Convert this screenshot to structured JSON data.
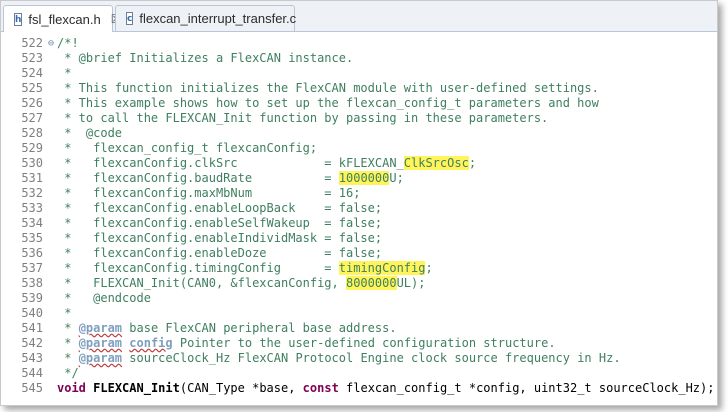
{
  "tabs": [
    {
      "label": "fsl_flexcan.h",
      "icon": "header-file-icon",
      "glyph": "h",
      "close": "☒",
      "active": true
    },
    {
      "label": "flexcan_interrupt_transfer.c",
      "icon": "c-file-icon",
      "glyph": "c",
      "active": false
    }
  ],
  "editor": {
    "fold_marker": "⊖",
    "lines": [
      {
        "num": "522",
        "segs": [
          {
            "t": "/*!"
          }
        ]
      },
      {
        "num": "523",
        "segs": [
          {
            "t": " * @brief Initializes a FlexCAN instance."
          }
        ]
      },
      {
        "num": "524",
        "segs": [
          {
            "t": " *"
          }
        ]
      },
      {
        "num": "525",
        "segs": [
          {
            "t": " * This function initializes the FlexCAN module with user-defined settings."
          }
        ]
      },
      {
        "num": "526",
        "segs": [
          {
            "t": " * This example shows how to set up the flexcan_config_t parameters and how"
          }
        ]
      },
      {
        "num": "527",
        "segs": [
          {
            "t": " * to call the FLEXCAN_Init function by passing in these parameters."
          }
        ]
      },
      {
        "num": "528",
        "segs": [
          {
            "t": " *  @code"
          }
        ]
      },
      {
        "num": "529",
        "segs": [
          {
            "t": " *   flexcan_config_t flexcanConfig;"
          }
        ]
      },
      {
        "num": "530",
        "segs": [
          {
            "t": " *   flexcanConfig.clkSrc            = kFLEXCAN_"
          },
          {
            "t": "ClkSrcOsc",
            "hl": true
          },
          {
            "t": ";"
          }
        ]
      },
      {
        "num": "531",
        "segs": [
          {
            "t": " *   flexcanConfig.baudRate          = "
          },
          {
            "t": "1000000",
            "hl": true
          },
          {
            "t": "U;"
          }
        ]
      },
      {
        "num": "532",
        "segs": [
          {
            "t": " *   flexcanConfig.maxMbNum          = 16;"
          }
        ]
      },
      {
        "num": "533",
        "segs": [
          {
            "t": " *   flexcanConfig.enableLoopBack    = false;"
          }
        ]
      },
      {
        "num": "534",
        "segs": [
          {
            "t": " *   flexcanConfig.enableSelfWakeup  = false;"
          }
        ]
      },
      {
        "num": "535",
        "segs": [
          {
            "t": " *   flexcanConfig.enableIndividMask = false;"
          }
        ]
      },
      {
        "num": "536",
        "segs": [
          {
            "t": " *   flexcanConfig.enableDoze        = false;"
          }
        ]
      },
      {
        "num": "537",
        "segs": [
          {
            "t": " *   flexcanConfig.timingConfig      = "
          },
          {
            "t": "timingConfig",
            "hl": true
          },
          {
            "t": ";"
          }
        ]
      },
      {
        "num": "538",
        "segs": [
          {
            "t": " *   FLEXCAN_Init(CAN0, &flexcanConfig, "
          },
          {
            "t": "8000000",
            "hl": true
          },
          {
            "t": "UL);"
          }
        ]
      },
      {
        "num": "539",
        "segs": [
          {
            "t": " *   @endcode"
          }
        ]
      },
      {
        "num": "540",
        "segs": [
          {
            "t": " *"
          }
        ]
      },
      {
        "num": "541",
        "segs": [
          {
            "t": " * "
          },
          {
            "t": "@param",
            "u": true
          },
          {
            "t": " base FlexCAN peripheral base address."
          }
        ]
      },
      {
        "num": "542",
        "segs": [
          {
            "t": " * "
          },
          {
            "t": "@param",
            "u": true
          },
          {
            "t": " "
          },
          {
            "t": "config",
            "u": true
          },
          {
            "t": " Pointer to the user-defined configuration structure."
          }
        ]
      },
      {
        "num": "543",
        "segs": [
          {
            "t": " * "
          },
          {
            "t": "@param",
            "u": true
          },
          {
            "t": " sourceClock_Hz FlexCAN Protocol Engine clock source frequency in Hz."
          }
        ]
      },
      {
        "num": "544",
        "segs": [
          {
            "t": " */"
          }
        ]
      },
      {
        "num": "545",
        "decl": true,
        "segs": [
          {
            "t": "void",
            "kw": true
          },
          {
            "t": " "
          },
          {
            "t": "FLEXCAN_Init",
            "fn": true
          },
          {
            "t": "(CAN_Type *base, "
          },
          {
            "t": "const",
            "kw": true
          },
          {
            "t": " flexcan_config_t *config, uint32_t sourceClock_Hz);"
          }
        ]
      }
    ]
  },
  "colors": {
    "comment": "#3f7f5f",
    "keyword": "#7f0055",
    "highlight": "#fff55a",
    "line_number": "#7f7f7f"
  }
}
